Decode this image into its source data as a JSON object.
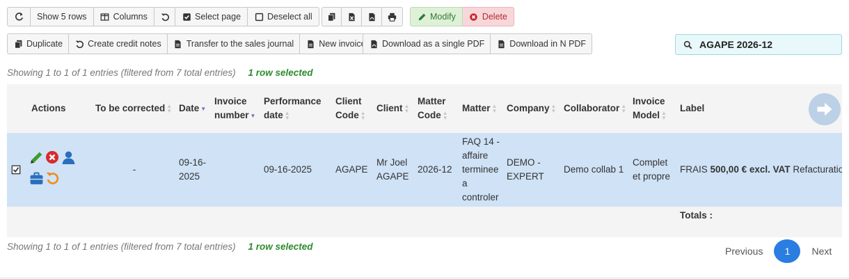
{
  "toolbar1": {
    "show_rows": "Show 5 rows",
    "columns": "Columns",
    "select_page": "Select page",
    "deselect_all": "Deselect all",
    "modify": "Modify",
    "delete": "Delete"
  },
  "toolbar2": {
    "duplicate": "Duplicate",
    "credit_notes": "Create credit notes",
    "transfer": "Transfer to the sales journal",
    "new_invoice": "New invoice",
    "single_pdf": "Download as a single PDF",
    "n_pdf": "Download in N PDF"
  },
  "search": {
    "value": "AGAPE 2026-12"
  },
  "info": {
    "showing": "Showing 1 to 1 of 1 entries (filtered from 7 total entries)",
    "selected": "1 row selected"
  },
  "columns": {
    "actions": "Actions",
    "to_be_corrected": "To be corrected",
    "date": "Date",
    "invoice_number": "Invoice number",
    "performance_date": "Performance date",
    "client_code": "Client Code",
    "client": "Client",
    "matter_code": "Matter Code",
    "matter": "Matter",
    "company": "Company",
    "collaborator": "Collaborator",
    "invoice_model": "Invoice Model",
    "label": "Label"
  },
  "row": {
    "to_be_corrected": "-",
    "date": "09-16-2025",
    "invoice_number": "",
    "performance_date": "09-16-2025",
    "client_code": "AGAPE",
    "client": "Mr Joel AGAPE",
    "matter_code": "2026-12",
    "matter": "FAQ 14 - affaire terminee a controler",
    "company": "DEMO - EXPERT",
    "collaborator": "Demo collab 1",
    "invoice_model": "Complet et propre",
    "label_prefix": "FRAIS",
    "label_amount": "500,00 € excl. VAT",
    "label_suffix": "Refacturation"
  },
  "totals_label": "Totals :",
  "pagination": {
    "previous": "Previous",
    "current": "1",
    "next": "Next"
  },
  "colors": {
    "selected_row": "#cfe2f6",
    "accent": "#2a7de1",
    "modify": "#2e7d32",
    "delete": "#c62828"
  }
}
